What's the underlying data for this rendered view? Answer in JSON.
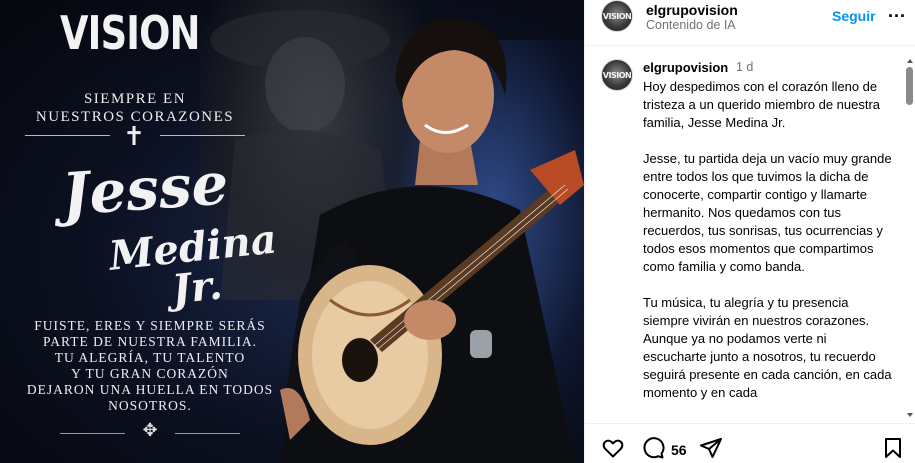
{
  "poster": {
    "logo": "VISION",
    "line1": "SIEMPRE EN",
    "line2": "NUESTROS CORAZONES",
    "cross": "✝",
    "name_first": "Jesse",
    "name_last": "Medina Jr.",
    "body": [
      "FUISTE, ERES Y SIEMPRE SERÁS",
      "PARTE DE NUESTRA FAMILIA.",
      "TU ALEGRÍA, TU TALENTO",
      "Y TU GRAN CORAZÓN",
      "DEJARON UNA HUELLA EN TODOS",
      "NOSOTROS."
    ],
    "ornament": "✥"
  },
  "header": {
    "avatar_text": "VISION",
    "username": "elgrupovision",
    "sublabel": "Contenido de IA",
    "follow_label": "Seguir",
    "more_label": "..."
  },
  "caption": {
    "username": "elgrupovision",
    "time": "1 d",
    "paragraphs": [
      "Hoy despedimos con el corazón lleno de tristeza a un querido miembro de nuestra familia, Jesse Medina Jr.",
      "Jesse, tu partida deja un vacío muy grande entre todos los que tuvimos la dicha de conocerte, compartir contigo y llamarte hermanito. Nos quedamos con tus recuerdos, tus sonrisas, tus ocurrencias y todos esos momentos que compartimos como familia y como banda.",
      "Tu música, tu alegría y tu presencia siempre vivirán en nuestros corazones. Aunque ya no podamos verte ni escucharte junto a nosotros, tu recuerdo seguirá presente en cada canción, en cada momento y en cada"
    ]
  },
  "actions": {
    "comment_count": "56",
    "icons": [
      "heart-icon",
      "comment-icon",
      "share-icon",
      "bookmark-icon"
    ]
  },
  "colors": {
    "accent": "#0095f6",
    "muted": "#737373"
  }
}
